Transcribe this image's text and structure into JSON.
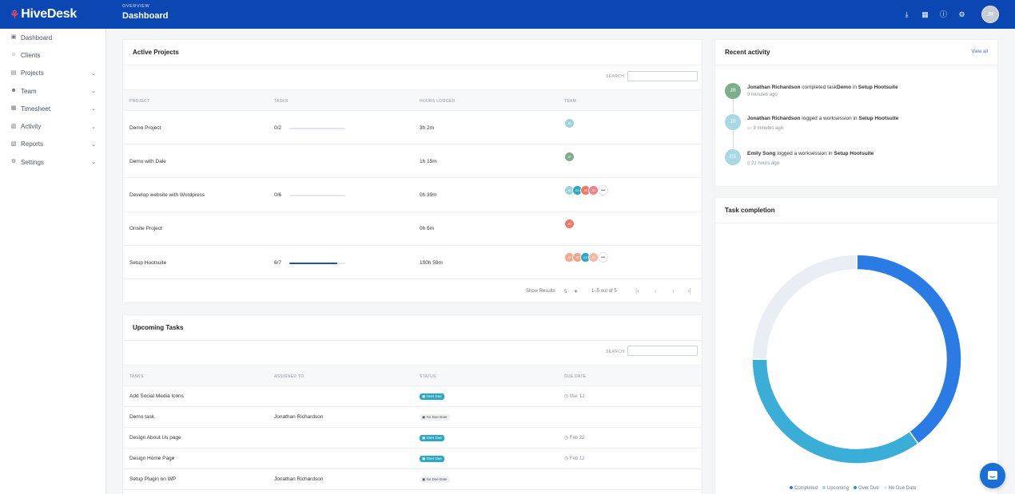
{
  "app": {
    "logo_text": "HiveDesk",
    "page_overline": "OVERVIEW",
    "page_title": "Dashboard"
  },
  "topbar": {
    "icons": [
      "download-icon",
      "map-icon",
      "help-icon",
      "settings-icon"
    ],
    "user_initials": "JR"
  },
  "sidebar": {
    "items": [
      {
        "label": "Dashboard",
        "icon": "dashboard-icon",
        "has_children": false
      },
      {
        "label": "Clients",
        "icon": "clients-icon",
        "has_children": false
      },
      {
        "label": "Projects",
        "icon": "folder-icon",
        "has_children": true
      },
      {
        "label": "Team",
        "icon": "team-icon",
        "has_children": true
      },
      {
        "label": "Timesheet",
        "icon": "timesheet-icon",
        "has_children": true
      },
      {
        "label": "Activity",
        "icon": "activity-icon",
        "has_children": true
      },
      {
        "label": "Reports",
        "icon": "reports-icon",
        "has_children": true
      },
      {
        "label": "Settings",
        "icon": "settings-icon",
        "has_children": true
      }
    ]
  },
  "active_projects": {
    "title": "Active Projects",
    "search_label": "SEARCH",
    "columns": [
      "PROJECT",
      "TASKS",
      "HOURS LOGGED",
      "TEAM"
    ],
    "rows": [
      {
        "project": "Demo Project",
        "tasks": "0/2",
        "progress": 0,
        "hours": "3h 2m",
        "team": [
          "JR"
        ],
        "more": false
      },
      {
        "project": "Demo with Dale",
        "tasks": "",
        "progress": null,
        "hours": "1h 15m",
        "team": [
          "JR"
        ],
        "more": false
      },
      {
        "project": "Develop website with Wordpress",
        "tasks": "0/6",
        "progress": 0,
        "hours": "0h 39m",
        "team": [
          "JR",
          "ES",
          "JR",
          "JR"
        ],
        "more": true
      },
      {
        "project": "Onsite Project",
        "tasks": "",
        "progress": null,
        "hours": "0h 5m",
        "team": [
          "JR"
        ],
        "more": false
      },
      {
        "project": "Setup Hootsuite",
        "tasks": "6/7",
        "progress": 0.857,
        "hours": "100h 59m",
        "team": [
          "JR",
          "JR",
          "ES",
          "JR"
        ],
        "more": true
      }
    ],
    "pager": {
      "show_results_label": "Show Results",
      "per_page": "5",
      "range": "1–5 out of 5"
    }
  },
  "upcoming_tasks": {
    "title": "Upcoming Tasks",
    "search_label": "SEARCH",
    "columns": [
      "TASKS",
      "ASSIGNED TO",
      "STATUS",
      "DUE DATE"
    ],
    "rows": [
      {
        "task": "Add Social Media Icons",
        "assigned": "",
        "status": "Over Due",
        "due": "Mar 12"
      },
      {
        "task": "Demo task",
        "assigned": "Jonathan Richardson",
        "status": "No Due Date",
        "due": ""
      },
      {
        "task": "Design About Us page",
        "assigned": "",
        "status": "Over Due",
        "due": "Feb 22"
      },
      {
        "task": "Design Home Page",
        "assigned": "",
        "status": "Over Due",
        "due": "Feb 12"
      },
      {
        "task": "Setup Plugin on WP",
        "assigned": "Jonathan Richardson",
        "status": "No Due Date",
        "due": ""
      }
    ]
  },
  "recent_activity": {
    "title": "Recent activity",
    "view_all": "View all",
    "items": [
      {
        "initials": "JR",
        "user": "Jonathan Richardson",
        "action": "completed task",
        "object": "Demo",
        "preposition": "in",
        "target": "Setup Hootsuite",
        "time": "9 minutes ago",
        "device": ""
      },
      {
        "initials": "JR",
        "user": "Jonathan Richardson",
        "action": "logged a worksession",
        "object": "",
        "preposition": "in",
        "target": "Setup Hootsuite",
        "time": "9 minutes ago",
        "device": "desktop-icon"
      },
      {
        "initials": "ES",
        "user": "Emily Song",
        "action": "logged a worksession",
        "object": "",
        "preposition": "in",
        "target": "Setup Hootsuite",
        "time": "21 hours ago",
        "device": "mobile-icon"
      }
    ]
  },
  "task_completion": {
    "title": "Task completion",
    "legend": [
      "Completed",
      "Upcoming",
      "Over Due",
      "No Due Date"
    ]
  },
  "chart_data": {
    "type": "pie",
    "title": "Task completion",
    "categories": [
      "Completed",
      "Upcoming",
      "Over Due",
      "No Due Date"
    ],
    "values": [
      40,
      35,
      0,
      25
    ],
    "colors": [
      "#2b7be4",
      "#3aaed6",
      "#1f9fbf",
      "#e9eef5"
    ],
    "donut": true,
    "legend_position": "bottom"
  },
  "colors": {
    "brand": "#0b47b3",
    "accent_red": "#e8485e",
    "progress": "#1f4fb5",
    "overdue_badge": "#2aa8c4"
  }
}
